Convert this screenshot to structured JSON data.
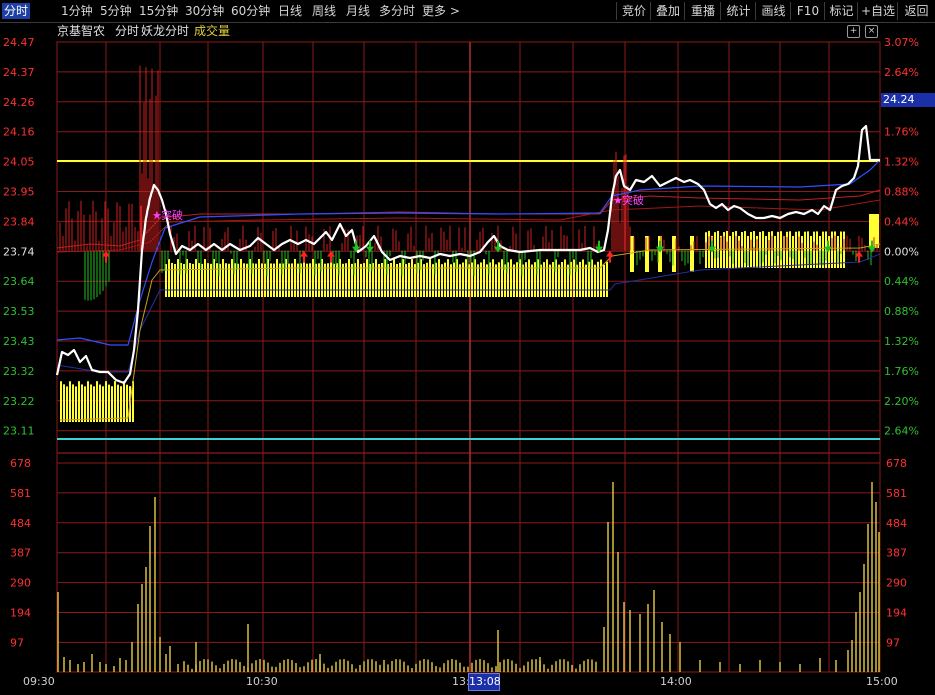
{
  "toolbar": {
    "periods": [
      "分时",
      "1分钟",
      "5分钟",
      "15分钟",
      "30分钟",
      "60分钟",
      "日线",
      "周线",
      "月线",
      "多分时",
      "更多 >"
    ],
    "active_period": "分时",
    "right_buttons": [
      "竞价",
      "叠加",
      "重播",
      "统计",
      "画线",
      "F10",
      "标记",
      "+自选",
      "返回"
    ]
  },
  "title": {
    "stock_name": "京基智农",
    "chart_name": "分时",
    "indicator": "妖龙分时",
    "volume_label": "成交量"
  },
  "price_axis": {
    "left": [
      "24.47",
      "24.37",
      "24.26",
      "24.16",
      "24.05",
      "23.95",
      "23.84",
      "23.74",
      "23.64",
      "23.53",
      "23.43",
      "23.32",
      "23.22",
      "23.11"
    ],
    "right": [
      "3.07%",
      "2.64%",
      "",
      "1.76%",
      "1.32%",
      "0.88%",
      "0.44%",
      "0.00%",
      "0.44%",
      "0.88%",
      "1.32%",
      "1.76%",
      "2.20%",
      "2.64%"
    ],
    "current_price": "24.24"
  },
  "volume_axis": {
    "labels": [
      "678",
      "581",
      "484",
      "387",
      "290",
      "194",
      "97"
    ]
  },
  "time_axis": {
    "labels": [
      "09:30",
      "10:30",
      "13:00",
      "14:00",
      "15:00"
    ],
    "cursor": "13:08"
  },
  "annotations": {
    "breakout1": "突破",
    "breakout2": "突破"
  },
  "colors": {
    "price_line": "#ffffff",
    "avg_line": "#3050ff",
    "grid": "#8b1a1a",
    "up_text": "#ff3030",
    "down_text": "#30c030",
    "bar_fill": "#ffff33",
    "ref_line_top": "#ffff33",
    "ref_line_bottom": "#40d0d0"
  }
}
